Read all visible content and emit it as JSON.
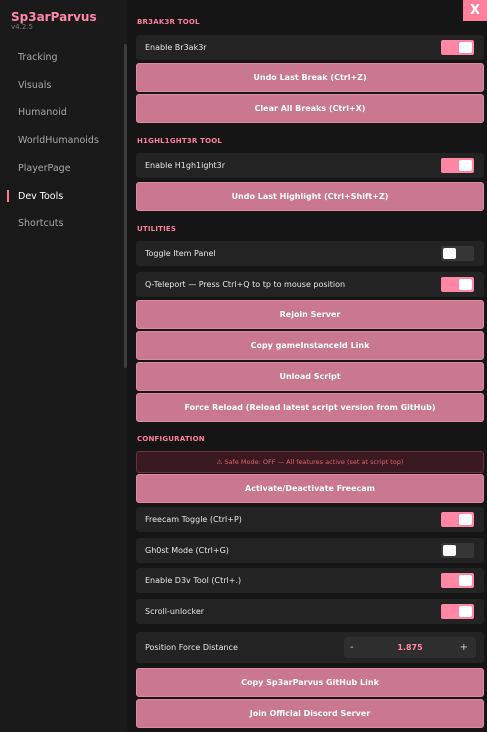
{
  "app": {
    "name": "Sp3arParvus",
    "version": "v4.2.5",
    "close_label": "X"
  },
  "sidebar": {
    "items": [
      {
        "label": "Tracking"
      },
      {
        "label": "Visuals"
      },
      {
        "label": "Humanoid"
      },
      {
        "label": "WorldHumanoids"
      },
      {
        "label": "PlayerPage"
      },
      {
        "label": "Dev Tools"
      },
      {
        "label": "Shortcuts"
      }
    ],
    "active": "Dev Tools"
  },
  "sections": {
    "breaker": "BR3AK3R TOOL",
    "highlighter": "H1GHL1GHT3R TOOL",
    "utilities": "UTILITIES",
    "configuration": "CONFIGURATION"
  },
  "breaker": {
    "enable_label": "Enable Br3ak3r",
    "enable_on": true,
    "undo_label": "Undo Last Break (Ctrl+Z)",
    "clear_label": "Clear All Breaks (Ctrl+X)"
  },
  "highlighter": {
    "enable_label": "Enable H1gh1ight3r",
    "enable_on": true,
    "undo_label": "Undo Last Highlight (Ctrl+Shift+Z)"
  },
  "utilities": {
    "item_panel_label": "Toggle Item Panel",
    "item_panel_on": false,
    "teleport_label": "Q-Teleport — Press Ctrl+Q to tp to mouse position",
    "teleport_on": true,
    "rejoin_label": "Rejoin Server",
    "copy_instance_label": "Copy gameInstanceId Link",
    "unload_label": "Unload Script",
    "force_reload_label": "Force Reload (Reload latest script version from GitHub)"
  },
  "configuration": {
    "warning_text": "⚠ Safe Mode: OFF — All features active (set at script top)",
    "freecam_button_label": "Activate/Deactivate Freecam",
    "freecam_toggle_label": "Freecam Toggle (Ctrl+P)",
    "freecam_toggle_on": true,
    "ghost_label": "Gh0st Mode (Ctrl+G)",
    "ghost_on": false,
    "dev_tool_label": "Enable D3v Tool (Ctrl+.)",
    "dev_tool_on": true,
    "scroll_label": "Scroll-unlocker",
    "scroll_on": true,
    "position_force_label": "Position Force Distance",
    "position_force_value": "1.875",
    "minus_label": "-",
    "plus_label": "+",
    "copy_github_label": "Copy Sp3arParvus GitHub Link",
    "join_discord_label": "Join Official Discord Server"
  },
  "colors": {
    "accent": "#ff7f9c",
    "button": "#c97890",
    "toggle_on": "#ff86a4",
    "toggle_off": "#363636"
  }
}
